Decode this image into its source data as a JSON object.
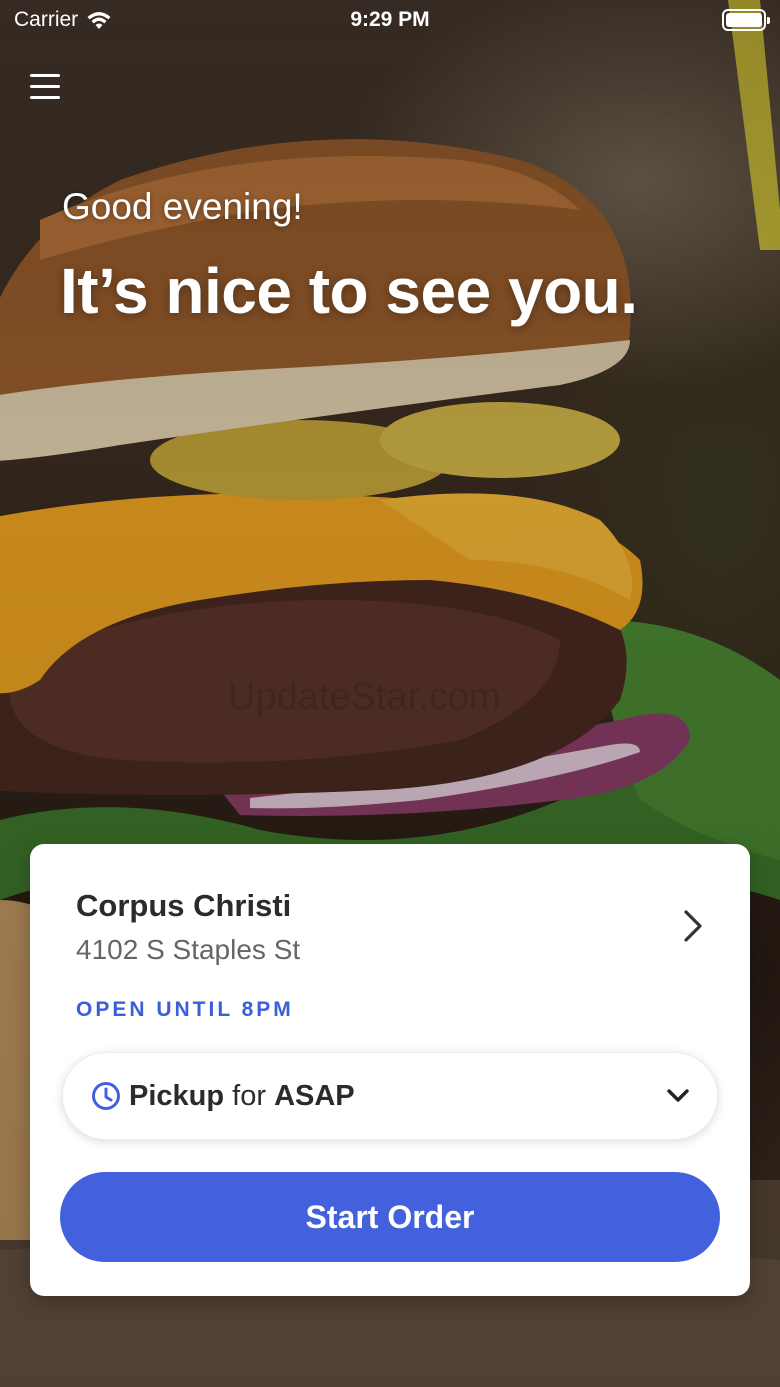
{
  "status_bar": {
    "carrier": "Carrier",
    "time": "9:29 PM"
  },
  "header": {
    "menu_icon": "hamburger-menu-icon",
    "greeting": "Good evening!",
    "headline": "It’s nice to see you."
  },
  "background": {
    "description_icon": "burger-photo",
    "watermark": "UpdateStar.com"
  },
  "location": {
    "name": "Corpus Christi",
    "address": "4102 S Staples St",
    "hours": "OPEN UNTIL 8PM"
  },
  "order_mode": {
    "mode": "Pickup",
    "connector": "for",
    "time": "ASAP"
  },
  "actions": {
    "start_order_label": "Start Order"
  },
  "colors": {
    "accent": "#4361dd",
    "hours_text": "#3c5ed8"
  }
}
